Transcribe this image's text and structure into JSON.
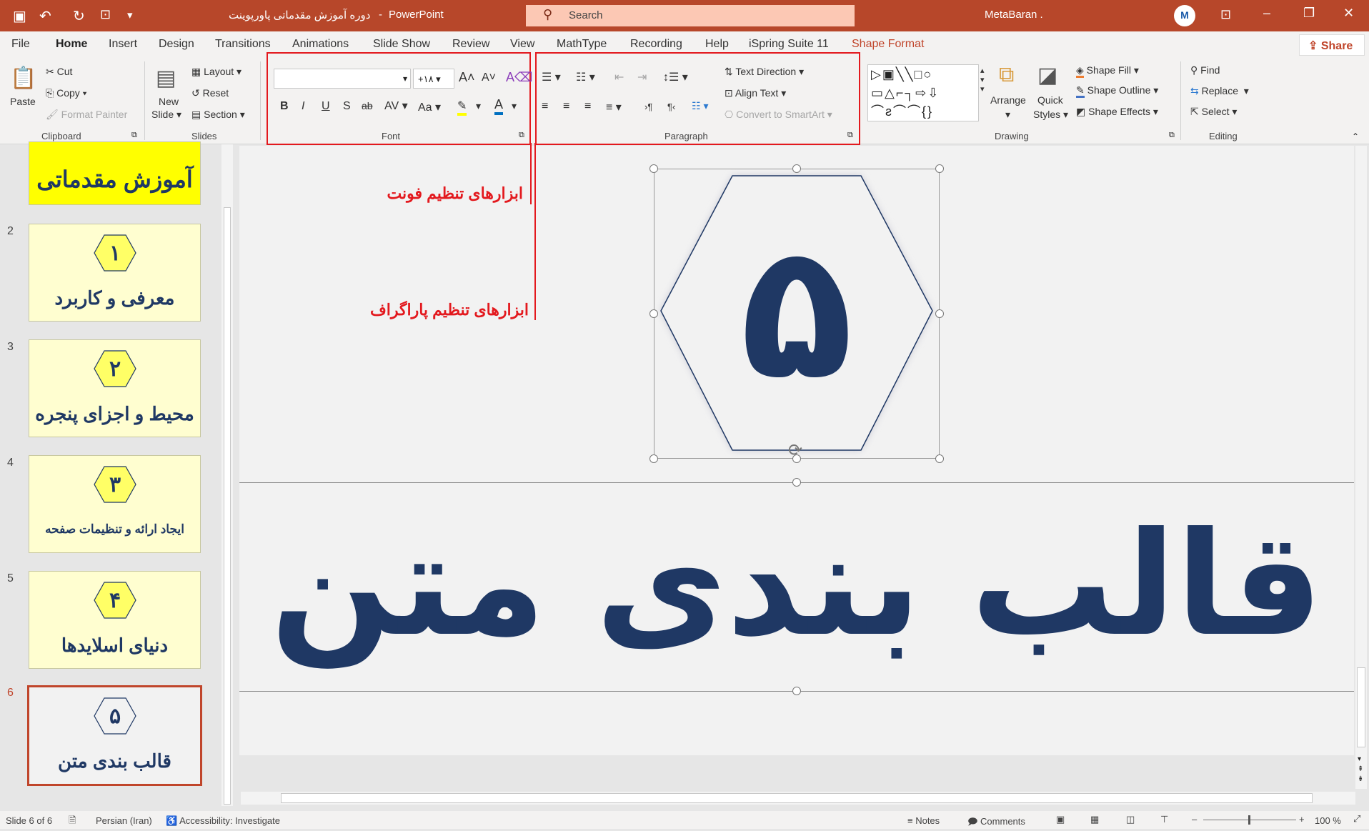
{
  "titlebar": {
    "doc_title": "دوره آموزش مقدماتی پاورپوینت",
    "app": "PowerPoint",
    "search_placeholder": "Search",
    "user": "MetaBaran .",
    "accent": "#b7472a"
  },
  "tabs": [
    {
      "label": "File"
    },
    {
      "label": "Home",
      "active": true
    },
    {
      "label": "Insert"
    },
    {
      "label": "Design"
    },
    {
      "label": "Transitions"
    },
    {
      "label": "Animations"
    },
    {
      "label": "Slide Show"
    },
    {
      "label": "Review"
    },
    {
      "label": "View"
    },
    {
      "label": "MathType"
    },
    {
      "label": "Recording"
    },
    {
      "label": "Help"
    },
    {
      "label": "iSpring Suite 11"
    },
    {
      "label": "Shape Format"
    }
  ],
  "share_label": "Share",
  "ribbon": {
    "clipboard": {
      "paste": "Paste",
      "cut": "Cut",
      "copy": "Copy",
      "format_painter": "Format Painter",
      "group": "Clipboard"
    },
    "slides": {
      "new_slide_1": "New",
      "new_slide_2": "Slide",
      "layout": "Layout",
      "reset": "Reset",
      "section": "Section",
      "group": "Slides"
    },
    "font": {
      "font_name": "",
      "font_size": "+۱۸",
      "bold": "B",
      "italic": "I",
      "underline": "U",
      "shadow": "S",
      "strike": "ab",
      "spacing": "AV",
      "case": "Aa",
      "font_color": "A",
      "group": "Font"
    },
    "paragraph": {
      "text_direction": "Text Direction",
      "align_text": "Align Text",
      "smartart": "Convert to SmartArt",
      "group": "Paragraph"
    },
    "drawing": {
      "arrange": "Arrange",
      "quick_styles_1": "Quick",
      "quick_styles_2": "Styles",
      "shape_fill": "Shape Fill",
      "shape_outline": "Shape Outline",
      "shape_effects": "Shape Effects",
      "group": "Drawing"
    },
    "editing": {
      "find": "Find",
      "replace": "Replace",
      "select": "Select",
      "group": "Editing"
    }
  },
  "annotations": {
    "font_tools": "ابزارهای تنظیم فونت",
    "paragraph_tools": "ابزارهای تنظیم پاراگراف",
    "color": "#e3191e"
  },
  "thumbnails": [
    {
      "num": "",
      "badge": "",
      "title": "آموزش مقدماتی"
    },
    {
      "num": "2",
      "badge": "۱",
      "title": "معرفی و کاربرد"
    },
    {
      "num": "3",
      "badge": "۲",
      "title": "محیط و اجزای پنجره"
    },
    {
      "num": "4",
      "badge": "۳",
      "title": "ایجاد ارائه و تنظیمات صفحه"
    },
    {
      "num": "5",
      "badge": "۴",
      "title": "دنیای اسلایدها"
    },
    {
      "num": "6",
      "badge": "۵",
      "title": "قالب بندی متن",
      "selected": true
    }
  ],
  "slide": {
    "number_glyph": "۵",
    "title": "قالب بندی متن",
    "text_color": "#1f3864"
  },
  "status": {
    "slide": "Slide 6 of 6",
    "language": "Persian (Iran)",
    "accessibility": "Accessibility: Investigate",
    "notes": "Notes",
    "comments": "Comments",
    "zoom": "100 %",
    "zoom_percent": 100
  }
}
